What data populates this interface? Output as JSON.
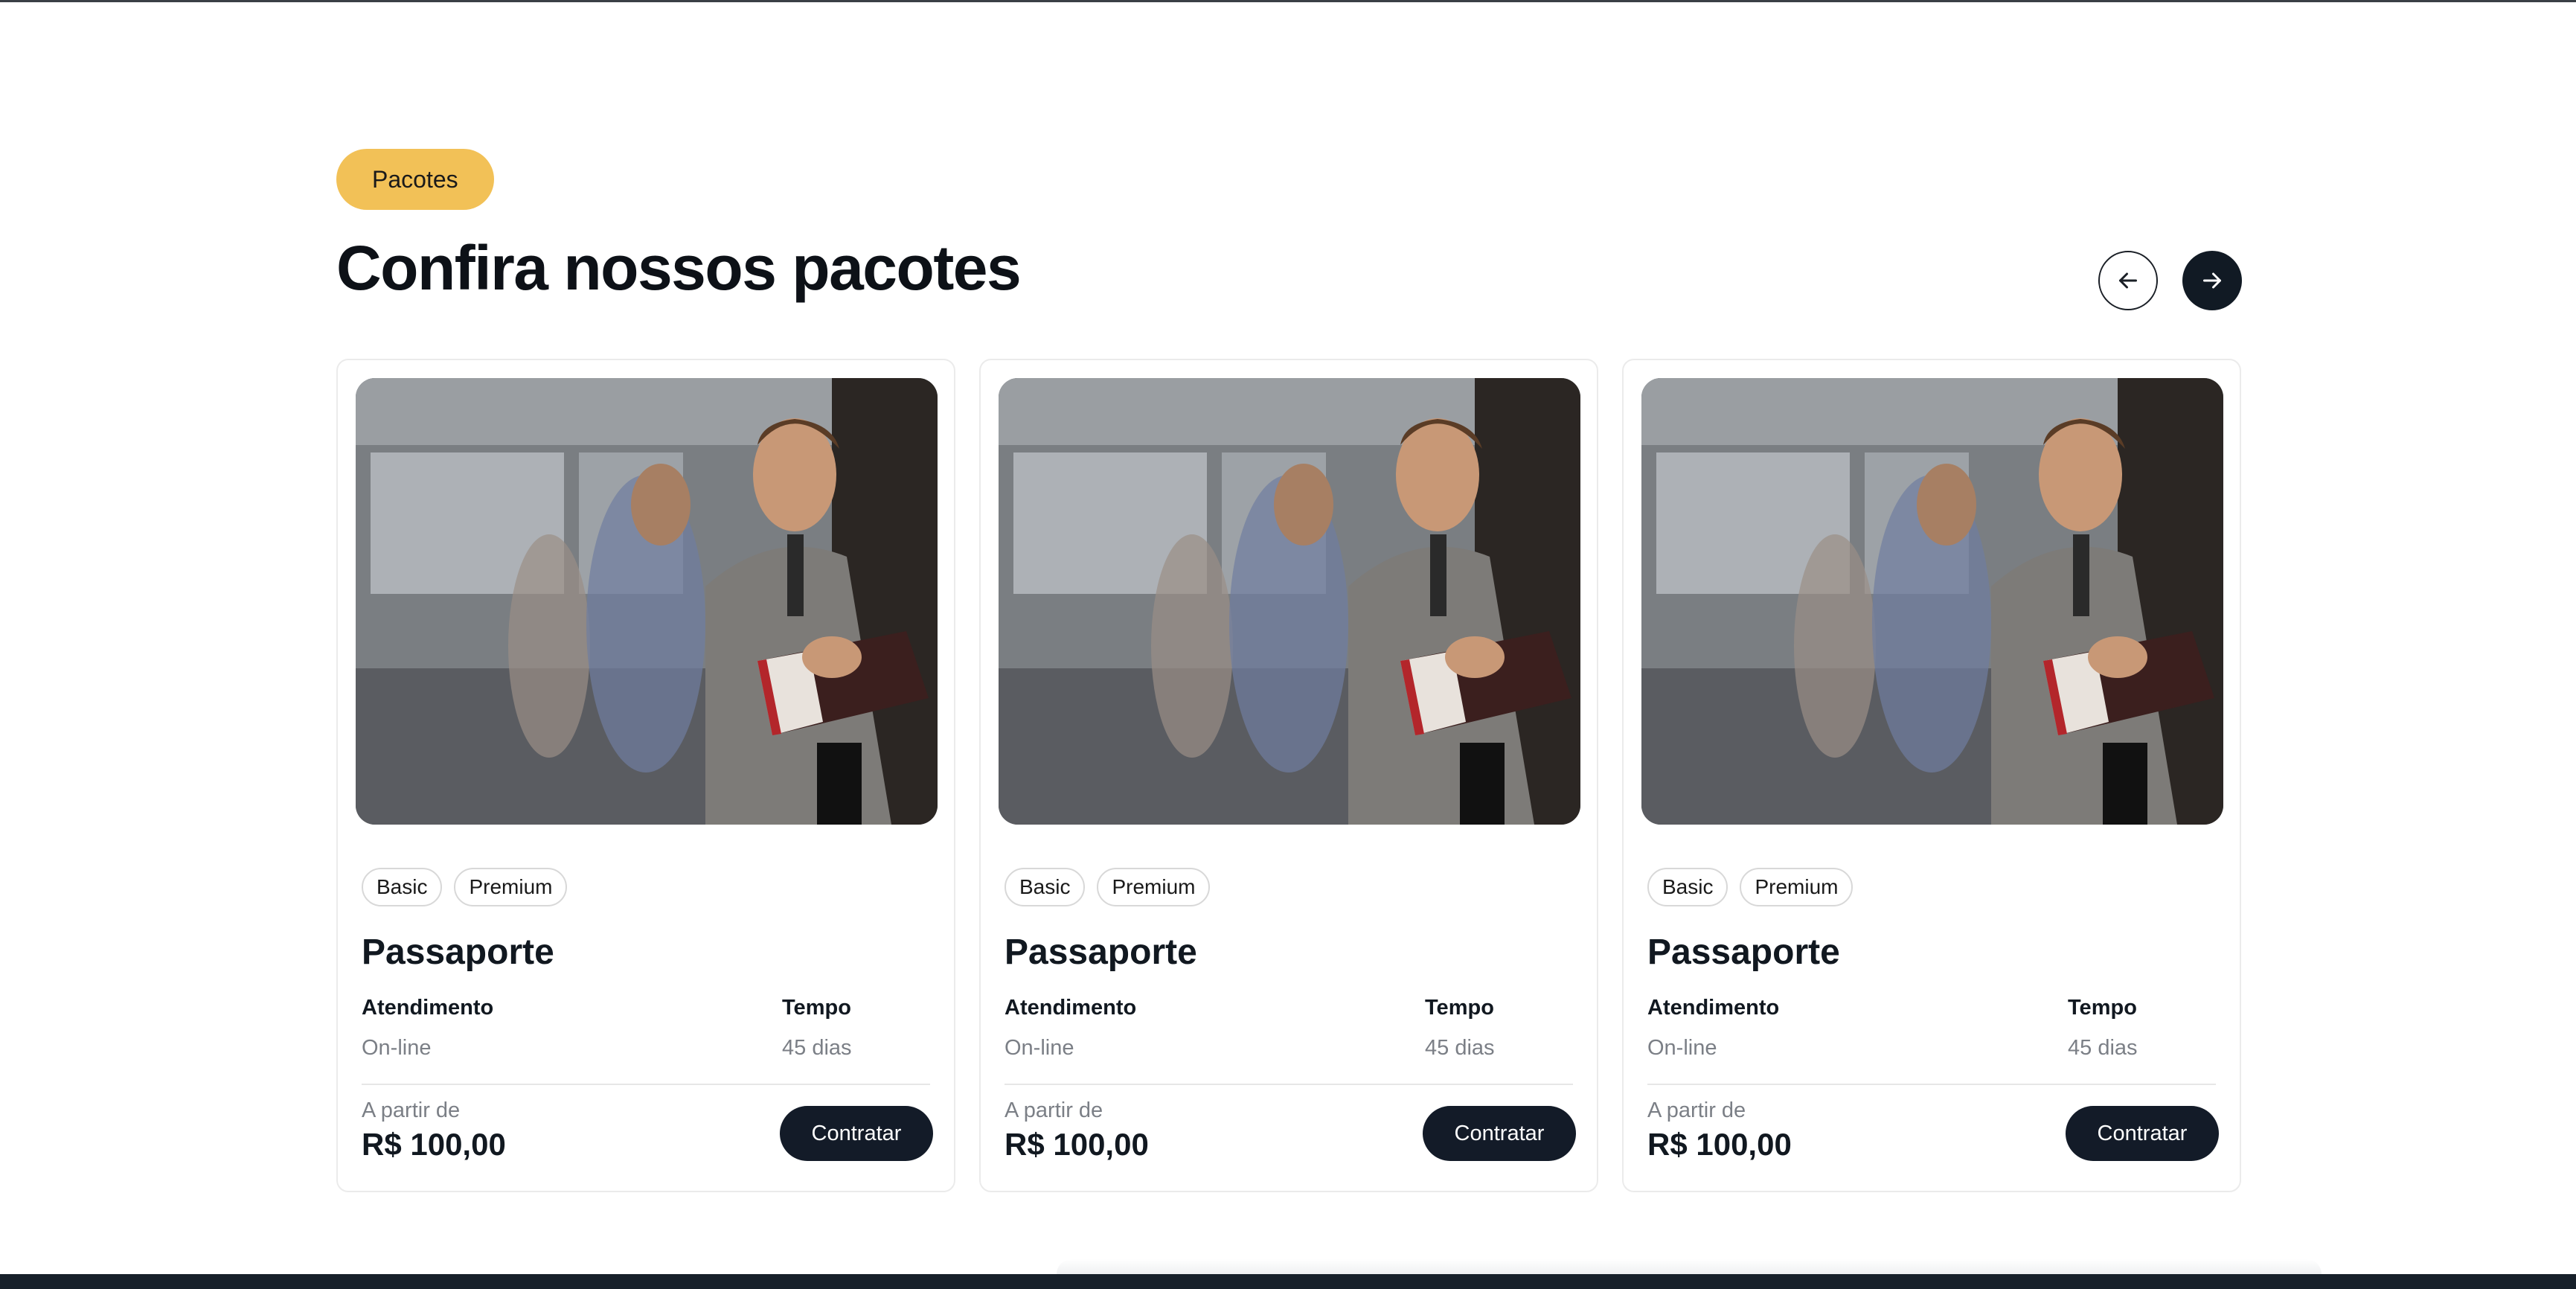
{
  "section": {
    "badge": "Pacotes",
    "title": "Confira nossos pacotes",
    "nav": {
      "prev_icon": "arrow-left-icon",
      "next_icon": "arrow-right-icon"
    }
  },
  "cards": [
    {
      "image_alt": "Homem sorrindo segurando passaporte no aeroporto",
      "tags": [
        "Basic",
        "Premium"
      ],
      "title": "Passaporte",
      "service_label": "Atendimento",
      "service_value": "On-line",
      "time_label": "Tempo",
      "time_value": "45 dias",
      "price_label": "A partir de",
      "price": "R$ 100,00",
      "cta": "Contratar"
    },
    {
      "image_alt": "Homem sorrindo segurando passaporte no aeroporto",
      "tags": [
        "Basic",
        "Premium"
      ],
      "title": "Passaporte",
      "service_label": "Atendimento",
      "service_value": "On-line",
      "time_label": "Tempo",
      "time_value": "45 dias",
      "price_label": "A partir de",
      "price": "R$ 100,00",
      "cta": "Contratar"
    },
    {
      "image_alt": "Homem sorrindo segurando passaporte no aeroporto",
      "tags": [
        "Basic",
        "Premium"
      ],
      "title": "Passaporte",
      "service_label": "Atendimento",
      "service_value": "On-line",
      "time_label": "Tempo",
      "time_value": "45 dias",
      "price_label": "A partir de",
      "price": "R$ 100,00",
      "cta": "Contratar"
    }
  ],
  "colors": {
    "badge_bg": "#f2c157",
    "dark": "#131b28",
    "muted_text": "#7b7f86"
  }
}
